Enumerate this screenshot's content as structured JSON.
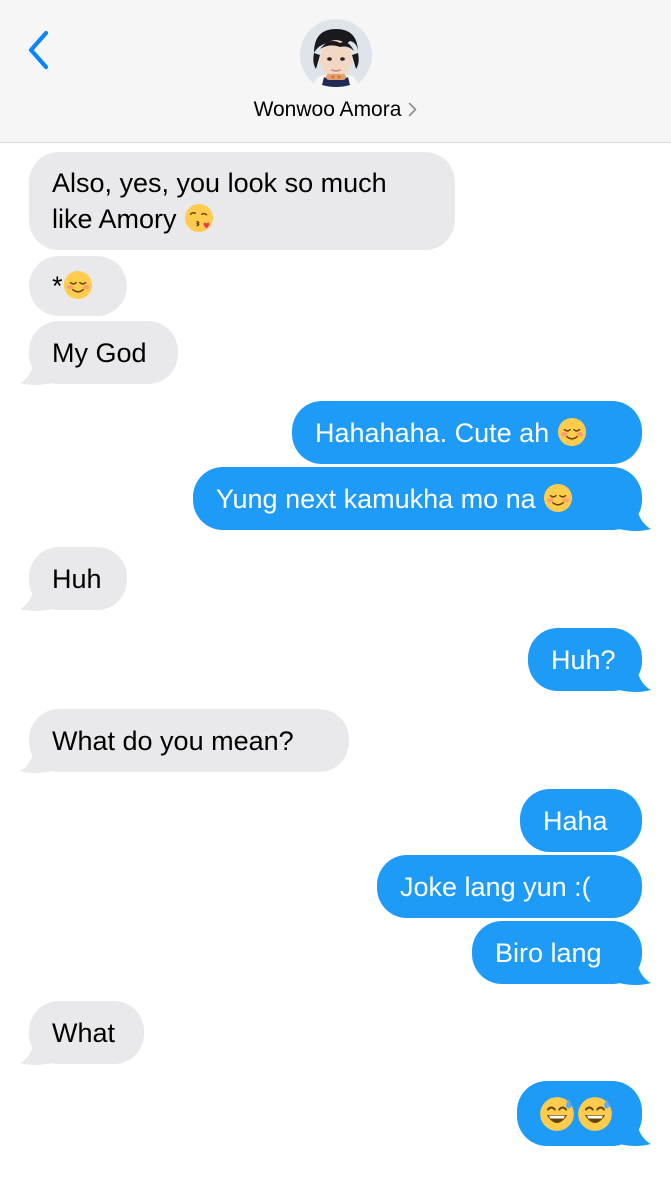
{
  "header": {
    "contact_name": "Wonwoo Amora",
    "back_icon": "chevron-left-icon",
    "chevron_icon": "chevron-right-icon"
  },
  "colors": {
    "incoming_bubble": "#e9e9eb",
    "outgoing_bubble": "#1d9bf6",
    "accent": "#0a84ff"
  },
  "messages": [
    {
      "dir": "in",
      "line1": "Also, yes, you look so much",
      "line2": "like Amory",
      "emoji": "kissing-heart-emoji"
    },
    {
      "dir": "in",
      "text": "*",
      "emoji": "relieved-smile-emoji"
    },
    {
      "dir": "in",
      "text": "My God"
    },
    {
      "dir": "out",
      "text": "Hahahaha. Cute ah",
      "emoji": "relieved-smile-emoji"
    },
    {
      "dir": "out",
      "text": "Yung next kamukha mo na",
      "emoji": "relieved-smile-emoji"
    },
    {
      "dir": "in",
      "text": "Huh"
    },
    {
      "dir": "out",
      "text": "Huh?"
    },
    {
      "dir": "in",
      "text": "What do you mean?"
    },
    {
      "dir": "out",
      "text": "Haha"
    },
    {
      "dir": "out",
      "text": "Joke lang yun :("
    },
    {
      "dir": "out",
      "text": "Biro lang"
    },
    {
      "dir": "in",
      "text": "What"
    },
    {
      "dir": "out",
      "emoji": "grinning-sweat-emoji",
      "emoji_count": 2
    }
  ]
}
